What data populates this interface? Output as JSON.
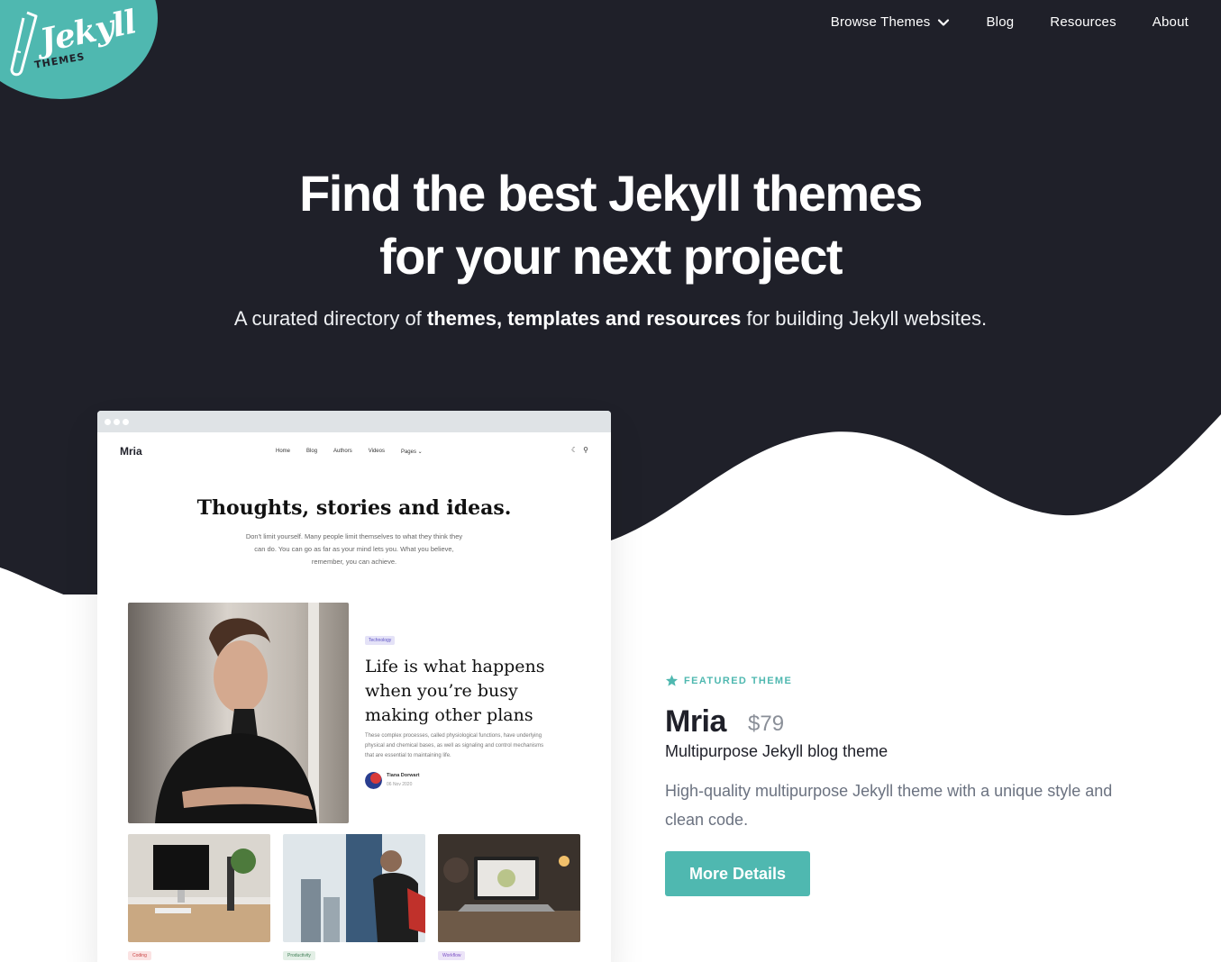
{
  "logo": {
    "word": "Jekyll",
    "sub": "THEMES"
  },
  "nav": {
    "items": [
      {
        "label": "Browse Themes",
        "has_dropdown": true
      },
      {
        "label": "Blog"
      },
      {
        "label": "Resources"
      },
      {
        "label": "About"
      }
    ]
  },
  "hero": {
    "line1": "Find the best Jekyll themes",
    "line2": "for your next project",
    "sub_pre": "A curated directory of ",
    "sub_bold": "themes, templates and resources",
    "sub_post": " for building Jekyll websites."
  },
  "preview": {
    "site_name": "Mria",
    "links": [
      "Home",
      "Blog",
      "Authors",
      "Videos",
      "Pages"
    ],
    "title": "Thoughts, stories and ideas.",
    "description": "Don't limit yourself. Many people limit themselves to what they think they can do. You can go as far as your mind lets you. What you believe, remember, you can achieve.",
    "post_tag": "Technology",
    "post_title": "Life is what happens when you’re busy making other plans",
    "post_desc": "These complex processes, called physiological functions, have underlying physical and chemical bases, as well as signaling and control mechanisms that are essential to maintaining life.",
    "author": "Tiana Dorwart",
    "date": "06 Nov 2020",
    "thumb_tags": [
      "Coding",
      "Productivity",
      "Workflow"
    ]
  },
  "featured": {
    "label": "FEATURED THEME",
    "name": "Mria",
    "price": "$79",
    "tagline": "Multipurpose Jekyll blog theme",
    "description": "High-quality multipurpose Jekyll theme with a unique style and clean code.",
    "button": "More Details"
  },
  "colors": {
    "dark": "#1f2029",
    "accent": "#4fb8b0"
  }
}
